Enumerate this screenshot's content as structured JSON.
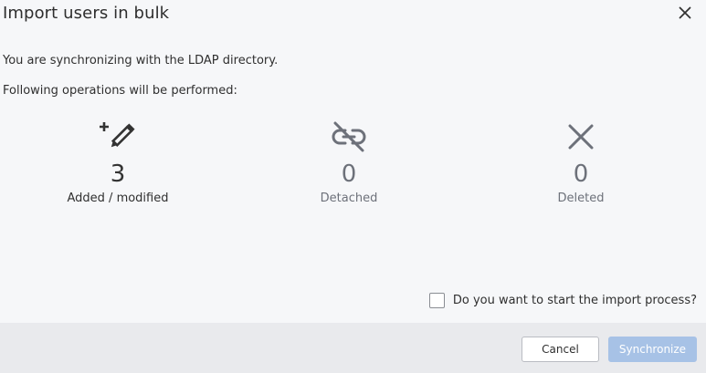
{
  "dialog": {
    "title": "Import users in bulk",
    "close_icon": "close-icon"
  },
  "body": {
    "sync_message": "You are synchronizing with the LDAP directory.",
    "operations_message": "Following operations will be performed:"
  },
  "stats": [
    {
      "icon": "edit-add-icon",
      "count": "3",
      "label": "Added / modified"
    },
    {
      "icon": "unlink-icon",
      "count": "0",
      "label": "Detached"
    },
    {
      "icon": "x-icon",
      "count": "0",
      "label": "Deleted"
    }
  ],
  "confirm": {
    "label": "Do you want to start the import process?",
    "checked": false
  },
  "footer": {
    "cancel_label": "Cancel",
    "synchronize_label": "Synchronize"
  },
  "colors": {
    "primary_disabled": "#a7c2e6",
    "muted_text": "#6d717a",
    "footer_bg": "#e9eaed"
  }
}
